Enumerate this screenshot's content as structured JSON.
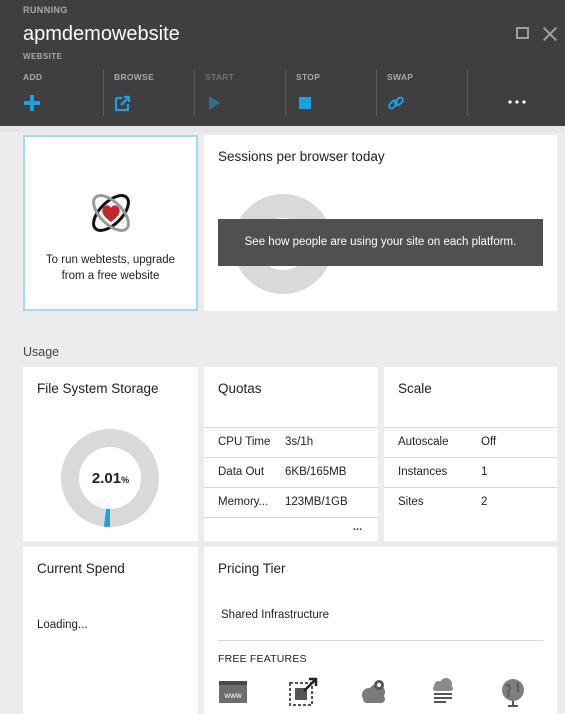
{
  "header": {
    "status": "RUNNING",
    "title": "apmdemowebsite",
    "subtitle": "WEBSITE"
  },
  "commands": [
    {
      "label": "ADD",
      "icon": "plus-icon",
      "enabled": true
    },
    {
      "label": "BROWSE",
      "icon": "external-link-icon",
      "enabled": true
    },
    {
      "label": "START",
      "icon": "play-icon",
      "enabled": false
    },
    {
      "label": "STOP",
      "icon": "stop-icon",
      "enabled": true
    },
    {
      "label": "SWAP",
      "icon": "link-icon",
      "enabled": true
    },
    {
      "label": "",
      "icon": "more-icon",
      "enabled": true
    }
  ],
  "colors": {
    "accent": "#1ba1e2",
    "header_bg": "#3f3f41",
    "donut_track": "#d9d9d9",
    "overlay_bg": "#4f5052",
    "selected_border": "#a8d8ee"
  },
  "webtest_tile": {
    "line1": "To run webtests, upgrade",
    "line2": "from a free website"
  },
  "sessions_tile": {
    "title": "Sessions per browser today",
    "overlay": "See how people are using your site on each platform."
  },
  "usage": {
    "label": "Usage",
    "file_system": {
      "title": "File System Storage",
      "value": "2.01",
      "unit": "%",
      "percent": 2.01
    },
    "quotas": {
      "title": "Quotas",
      "rows": [
        {
          "key": "CPU Time",
          "value": "3s/1h"
        },
        {
          "key": "Data Out",
          "value": "6KB/165MB"
        },
        {
          "key": "Memory...",
          "value": "123MB/1GB"
        }
      ],
      "more": "..."
    },
    "scale": {
      "title": "Scale",
      "rows": [
        {
          "key": "Autoscale",
          "value": "Off"
        },
        {
          "key": "Instances",
          "value": "1"
        },
        {
          "key": "Sites",
          "value": "2"
        }
      ]
    }
  },
  "spend": {
    "title": "Current Spend",
    "status": "Loading..."
  },
  "pricing": {
    "title": "Pricing Tier",
    "tier": "Shared Infrastructure",
    "features_label": "FREE FEATURES",
    "feature_icons": [
      "www-icon",
      "resize-icon",
      "cloud-gear-icon",
      "cloud-log-icon",
      "globe-icon"
    ],
    "www_text": "www"
  }
}
